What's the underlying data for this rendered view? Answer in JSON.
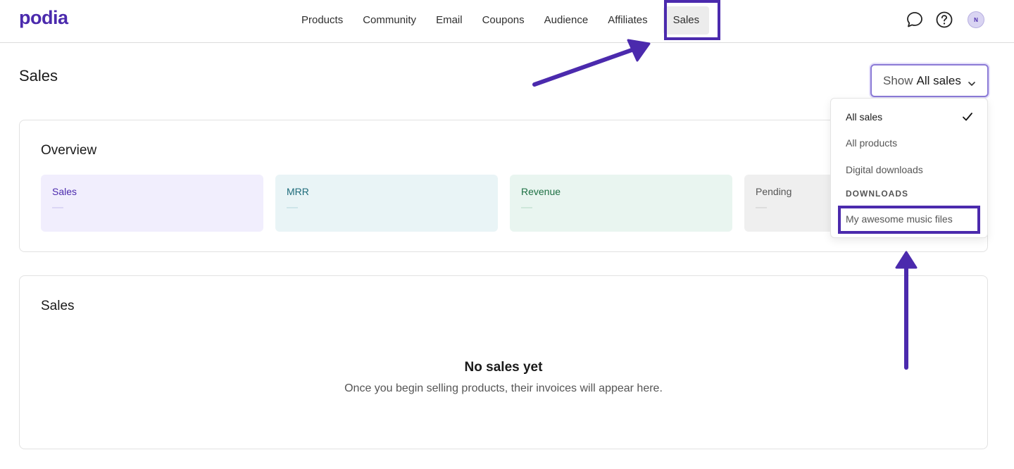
{
  "app": {
    "logo": "podia"
  },
  "nav": {
    "items": [
      {
        "label": "Products"
      },
      {
        "label": "Community"
      },
      {
        "label": "Email"
      },
      {
        "label": "Coupons"
      },
      {
        "label": "Audience"
      },
      {
        "label": "Affiliates"
      },
      {
        "label": "Sales",
        "active": true
      }
    ]
  },
  "header_icons": {
    "chat": "chat-bubble-icon",
    "help": "help-circle-icon",
    "avatar_initial": "N"
  },
  "page": {
    "title": "Sales"
  },
  "filter": {
    "prefix": "Show",
    "value": "All sales"
  },
  "overview": {
    "title": "Overview",
    "stats": [
      {
        "label": "Sales",
        "value": "—"
      },
      {
        "label": "MRR",
        "value": "—"
      },
      {
        "label": "Revenue",
        "value": "—"
      },
      {
        "label": "Pending",
        "value": "—"
      }
    ]
  },
  "sales": {
    "title": "Sales",
    "empty_title": "No sales yet",
    "empty_desc": "Once you begin selling products, their invoices will appear here."
  },
  "menu": {
    "items": [
      {
        "label": "All sales",
        "selected": true
      },
      {
        "label": "All products"
      },
      {
        "label": "Digital downloads"
      }
    ],
    "heading": "DOWNLOADS",
    "sub_items": [
      {
        "label": "My awesome music files"
      }
    ]
  },
  "colors": {
    "brand": "#4b2aad",
    "annotation": "#4b2aad"
  }
}
